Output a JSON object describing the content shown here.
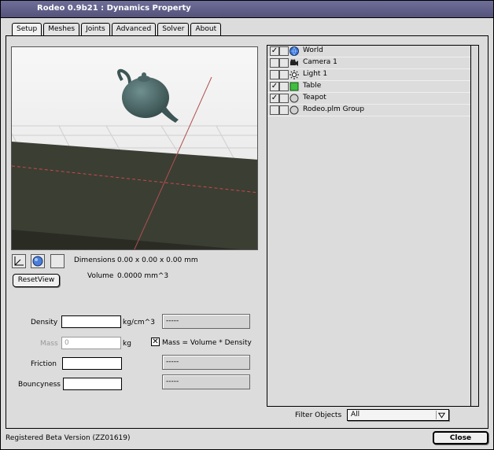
{
  "window": {
    "title": "Rodeo 0.9b21 : Dynamics Property"
  },
  "tabs": [
    {
      "label": "Setup",
      "active": true
    },
    {
      "label": "Meshes",
      "active": false
    },
    {
      "label": "Joints",
      "active": false
    },
    {
      "label": "Advanced",
      "active": false
    },
    {
      "label": "Solver",
      "active": false
    },
    {
      "label": "About",
      "active": false
    }
  ],
  "view": {
    "dimensions_label": "Dimensions",
    "dimensions_value": "0.00 x 0.00 x 0.00 mm",
    "volume_label": "Volume",
    "volume_value": "0.0000 mm^3",
    "reset_label": "ResetView",
    "icons": [
      "axis-icon",
      "sphere-icon",
      "box-icon"
    ]
  },
  "props": {
    "density_label": "Density",
    "density_value": "",
    "density_unit": "kg/cm^3",
    "mass_label": "Mass",
    "mass_value": "0",
    "mass_unit": "kg",
    "mass_checkbox_label": "Mass = Volume * Density",
    "mass_checkbox_checked": true,
    "friction_label": "Friction",
    "friction_value": "",
    "bouncyness_label": "Bouncyness",
    "bouncyness_value": "",
    "box1": "-----",
    "box2": "-----",
    "box3": "-----"
  },
  "objects": [
    {
      "label": "World",
      "checked": true,
      "icon": "globe-icon"
    },
    {
      "label": "Camera 1",
      "checked": false,
      "icon": "camera-icon"
    },
    {
      "label": "Light 1",
      "checked": false,
      "icon": "sun-icon"
    },
    {
      "label": "Table",
      "checked": true,
      "icon": "green-cube-icon"
    },
    {
      "label": "Teapot",
      "checked": true,
      "icon": "circle-icon"
    },
    {
      "label": "Rodeo.plm Group",
      "checked": false,
      "icon": "circle-icon"
    }
  ],
  "filter": {
    "label": "Filter Objects",
    "value": "All"
  },
  "status": {
    "text": "Registered Beta Version (ZZ01619)"
  },
  "close_label": "Close"
}
